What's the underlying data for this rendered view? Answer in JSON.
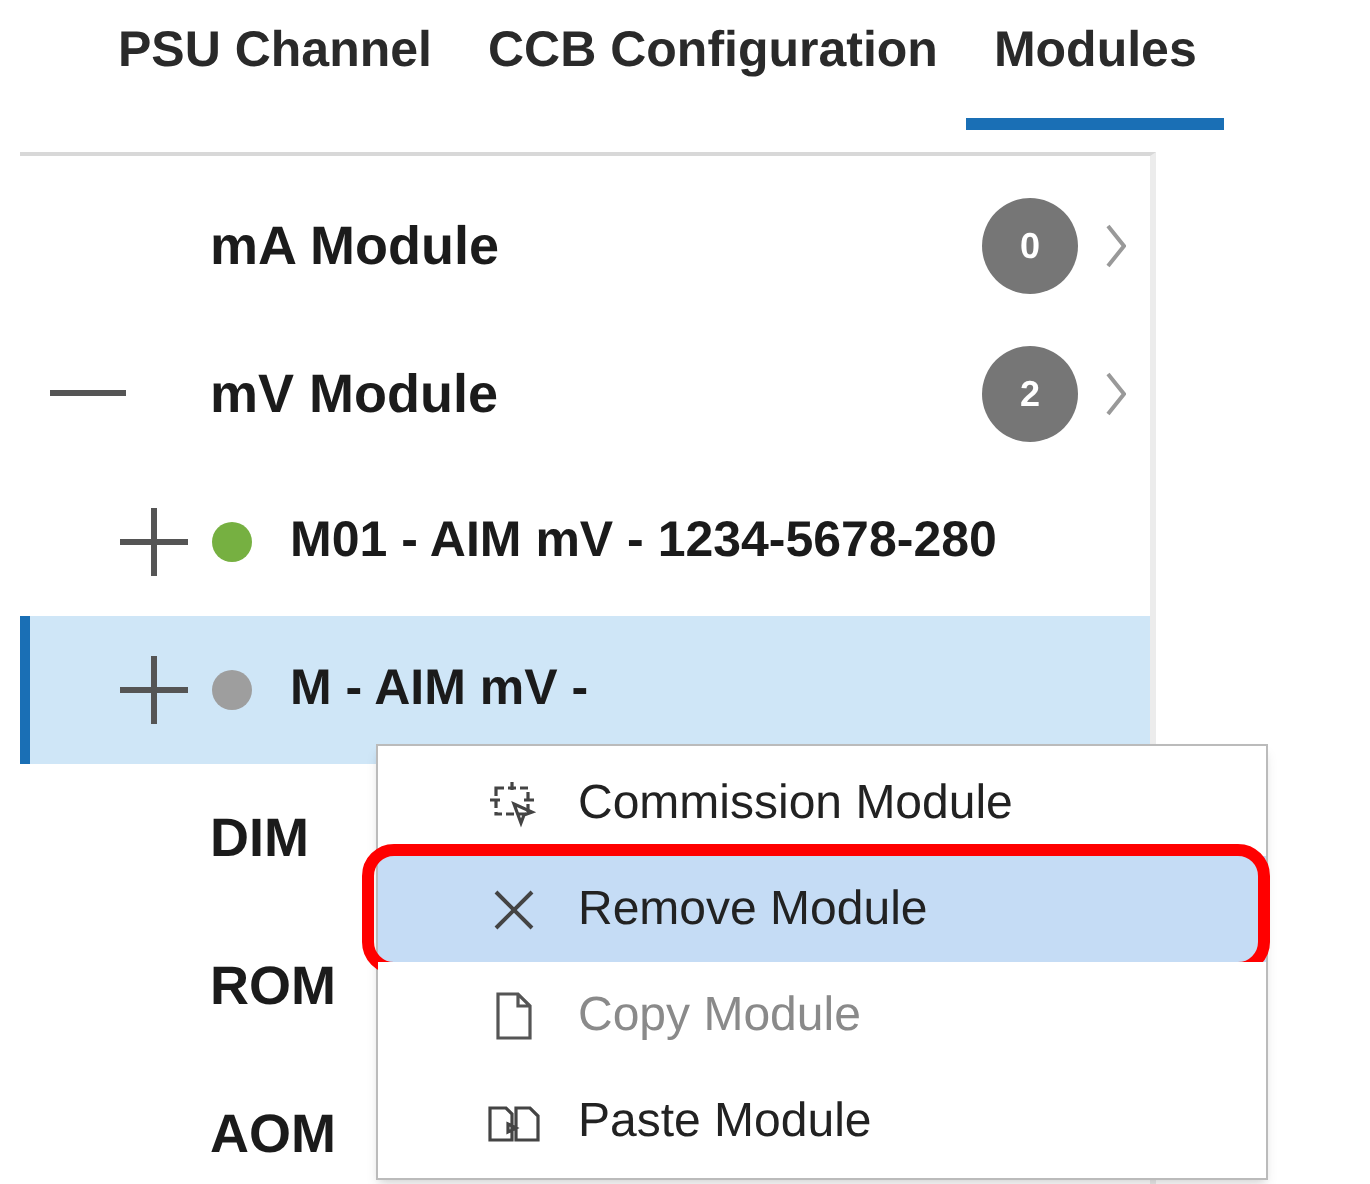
{
  "tabs": [
    {
      "label": "PSU Channel",
      "selected": false
    },
    {
      "label": "CCB Configuration",
      "selected": false
    },
    {
      "label": "Modules",
      "selected": true
    }
  ],
  "tree": [
    {
      "label": "mA Module",
      "count": "0",
      "expanded": false,
      "selected": false
    },
    {
      "label": "mV Module",
      "count": "2",
      "expanded": true,
      "selected": false,
      "children": [
        {
          "label": "M01 - AIM mV - 1234-5678-280",
          "color": "#76b041",
          "expanded": false,
          "selected": false
        },
        {
          "label": "M - AIM mV -",
          "color": "#9e9e9e",
          "expanded": false,
          "selected": true
        }
      ]
    },
    {
      "label": "DIM",
      "selected": false
    },
    {
      "label": "ROM",
      "selected": false
    },
    {
      "label": "AOM",
      "selected": false
    }
  ],
  "context_menu": [
    {
      "kind": "commission",
      "label": "Commission Module",
      "disabled": false,
      "selected": false,
      "callout": false
    },
    {
      "kind": "remove",
      "label": "Remove Module",
      "disabled": false,
      "selected": true,
      "callout": true
    },
    {
      "kind": "copy",
      "label": "Copy Module",
      "disabled": true,
      "selected": false,
      "callout": false
    },
    {
      "kind": "paste",
      "label": "Paste Module",
      "disabled": false,
      "selected": false,
      "callout": false
    }
  ]
}
